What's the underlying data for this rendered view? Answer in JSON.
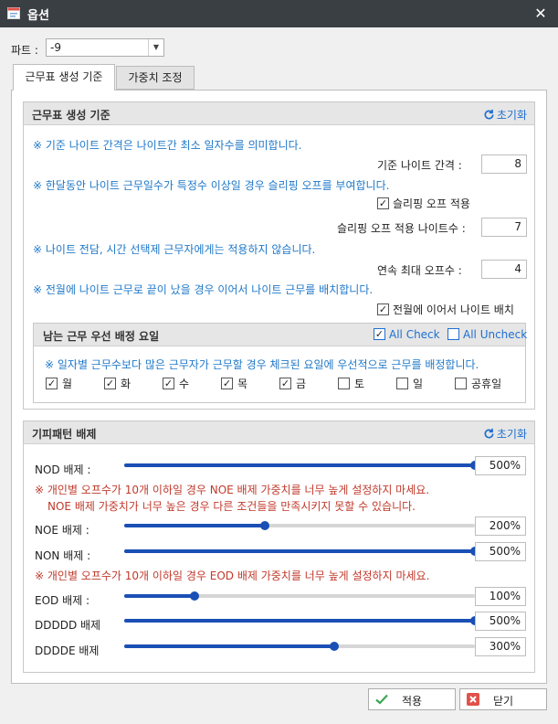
{
  "window": {
    "title": "옵션",
    "close_glyph": "✕"
  },
  "part": {
    "label": "파트 :",
    "value": "-9"
  },
  "tabs": [
    {
      "label": "근무표 생성 기준",
      "active": true
    },
    {
      "label": "가중치 조정",
      "active": false
    }
  ],
  "generation": {
    "title": "근무표 생성 기준",
    "reset_label": "초기화",
    "note1": "※ 기준 나이트 간격은 나이트간 최소 일자수를 의미합니다.",
    "night_gap_label": "기준 나이트 간격 :",
    "night_gap_value": "8",
    "note2": "※ 한달동안 나이트 근무일수가 특정수 이상일 경우 슬리핑 오프를 부여합니다.",
    "sleeping_off_label": "슬리핑 오프 적용",
    "sleeping_off_checked": true,
    "sleeping_nights_label": "슬리핑 오프 적용 나이트수 :",
    "sleeping_nights_value": "7",
    "note3": "※ 나이트 전담, 시간 선택제 근무자에게는 적용하지 않습니다.",
    "max_off_label": "연속 최대 오프수 :",
    "max_off_value": "4",
    "note4": "※ 전월에 나이트 근무로 끝이 났을 경우 이어서 나이트 근무를 배치합니다.",
    "continue_night_label": "전월에 이어서 나이트 배치",
    "continue_night_checked": true
  },
  "remaining": {
    "title": "남는 근무 우선 배정 요일",
    "all_check_label": "All Check",
    "all_check_checked": true,
    "all_uncheck_label": "All Uncheck",
    "all_uncheck_checked": false,
    "note": "※ 일자별 근무수보다 많은 근무자가 근무할 경우 체크된 요일에 우선적으로 근무를 배정합니다.",
    "days": [
      {
        "label": "월",
        "checked": true
      },
      {
        "label": "화",
        "checked": true
      },
      {
        "label": "수",
        "checked": true
      },
      {
        "label": "목",
        "checked": true
      },
      {
        "label": "금",
        "checked": true
      },
      {
        "label": "토",
        "checked": false
      },
      {
        "label": "일",
        "checked": false
      },
      {
        "label": "공휴일",
        "checked": false
      }
    ]
  },
  "avoid": {
    "title": "기피패턴 배제",
    "reset_label": "초기화",
    "sliders": [
      {
        "label": "NOD 배제 :",
        "value": "500%",
        "level": 1.0
      },
      {
        "label": "NOE 배제 :",
        "value": "200%",
        "level": 0.4
      },
      {
        "label": "NON 배제 :",
        "value": "500%",
        "level": 1.0
      },
      {
        "label": "EOD 배제 :",
        "value": "100%",
        "level": 0.2
      },
      {
        "label": "DDDDD 배제",
        "value": "500%",
        "level": 1.0
      },
      {
        "label": "DDDDE 배제",
        "value": "300%",
        "level": 0.6
      }
    ],
    "warn1a": "※ 개인별 오프수가 10개 이하일 경우 NOE 배제 가중치를 너무 높게 설정하지 마세요.",
    "warn1b": "NOE 배제 가중치가 너무 높은 경우 다른 조건들을 만족시키지 못할 수 있습니다.",
    "warn2": "※ 개인별 오프수가 10개 이하일 경우 EOD 배제 가중치를 너무 높게 설정하지 마세요."
  },
  "buttons": {
    "apply": "적용",
    "close": "닫기"
  },
  "colors": {
    "accent": "#1f6fd1",
    "slider": "#1a4fb5",
    "warning": "#c0392b",
    "note": "#1f78c8"
  }
}
